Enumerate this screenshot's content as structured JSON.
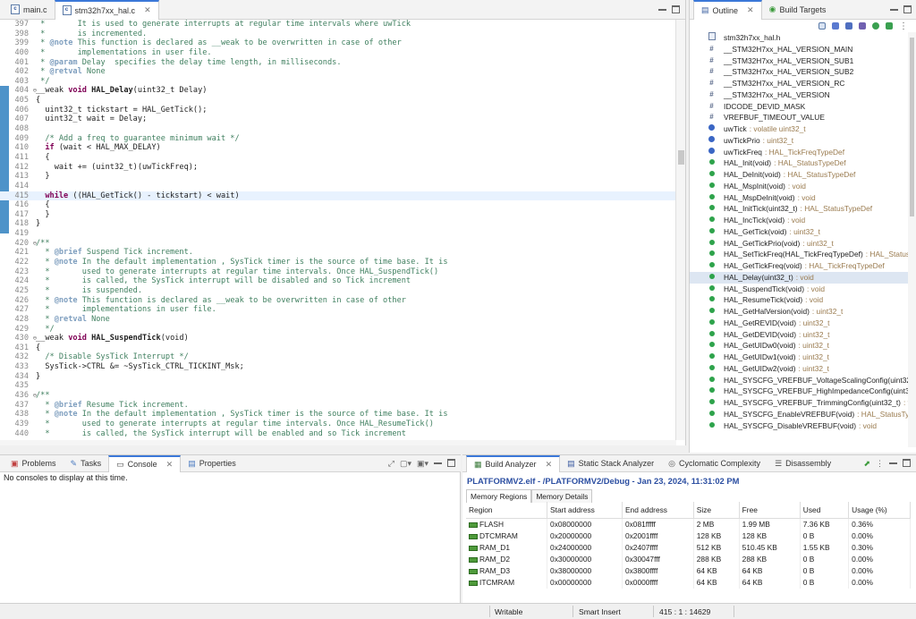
{
  "editor": {
    "tabs": [
      {
        "label": "main.c",
        "active": false
      },
      {
        "label": "stm32h7xx_hal.c",
        "active": true
      }
    ],
    "lines": [
      {
        "n": "397",
        "fold": "",
        "segs": [
          [
            "cm",
            " *       It is used to generate interrupts at regular time intervals where uwTick"
          ]
        ]
      },
      {
        "n": "398",
        "fold": "",
        "segs": [
          [
            "cm",
            " *       is incremented."
          ]
        ]
      },
      {
        "n": "399",
        "fold": "",
        "segs": [
          [
            "cm",
            " * "
          ],
          [
            "tg",
            "@note"
          ],
          [
            "cm",
            " This function is declared as __weak to be overwritten in case of other"
          ]
        ]
      },
      {
        "n": "400",
        "fold": "",
        "segs": [
          [
            "cm",
            " *       implementations in user file."
          ]
        ]
      },
      {
        "n": "401",
        "fold": "",
        "segs": [
          [
            "cm",
            " * "
          ],
          [
            "tg",
            "@param"
          ],
          [
            "cm",
            " Delay  specifies the delay time length, in milliseconds."
          ]
        ]
      },
      {
        "n": "402",
        "fold": "",
        "segs": [
          [
            "cm",
            " * "
          ],
          [
            "tg",
            "@retval"
          ],
          [
            "cm",
            " None"
          ]
        ]
      },
      {
        "n": "403",
        "fold": "",
        "segs": [
          [
            "cm",
            " */"
          ]
        ]
      },
      {
        "n": "404",
        "fold": "⊖",
        "segs": [
          [
            "",
            "__weak "
          ],
          [
            "kw",
            "void"
          ],
          [
            "",
            ""
          ],
          [
            "b",
            " HAL_Delay"
          ],
          [
            "",
            "(uint32_t Delay)"
          ]
        ]
      },
      {
        "n": "405",
        "fold": "",
        "segs": [
          [
            "",
            "{"
          ]
        ]
      },
      {
        "n": "406",
        "fold": "",
        "segs": [
          [
            "",
            "  uint32_t tickstart = HAL_GetTick();"
          ]
        ]
      },
      {
        "n": "407",
        "fold": "",
        "segs": [
          [
            "",
            "  uint32_t wait = Delay;"
          ]
        ]
      },
      {
        "n": "408",
        "fold": "",
        "segs": [
          [
            "",
            ""
          ]
        ]
      },
      {
        "n": "409",
        "fold": "",
        "segs": [
          [
            "cm",
            "  /* Add a freq to guarantee minimum wait */"
          ]
        ]
      },
      {
        "n": "410",
        "fold": "",
        "segs": [
          [
            "kw",
            "  if"
          ],
          [
            "",
            " (wait < HAL_MAX_DELAY)"
          ]
        ]
      },
      {
        "n": "411",
        "fold": "",
        "segs": [
          [
            "",
            "  {"
          ]
        ]
      },
      {
        "n": "412",
        "fold": "",
        "segs": [
          [
            "",
            "    wait += (uint32_t)(uwTickFreq);"
          ]
        ]
      },
      {
        "n": "413",
        "fold": "",
        "segs": [
          [
            "",
            "  }"
          ]
        ]
      },
      {
        "n": "414",
        "fold": "",
        "segs": [
          [
            "",
            ""
          ]
        ]
      },
      {
        "n": "415",
        "fold": "",
        "cur": true,
        "segs": [
          [
            "kw",
            "  while"
          ],
          [
            "",
            " ((HAL_GetTick() - tickstart) < wait)"
          ]
        ]
      },
      {
        "n": "416",
        "fold": "",
        "segs": [
          [
            "",
            "  {"
          ]
        ]
      },
      {
        "n": "417",
        "fold": "",
        "segs": [
          [
            "",
            "  }"
          ]
        ]
      },
      {
        "n": "418",
        "fold": "",
        "segs": [
          [
            "",
            "}"
          ]
        ]
      },
      {
        "n": "419",
        "fold": "",
        "segs": [
          [
            "",
            ""
          ]
        ]
      },
      {
        "n": "420",
        "fold": "⊖",
        "segs": [
          [
            "cm",
            "/**"
          ]
        ]
      },
      {
        "n": "421",
        "fold": "",
        "segs": [
          [
            "cm",
            "  * "
          ],
          [
            "tg",
            "@brief"
          ],
          [
            "cm",
            " Suspend Tick increment."
          ]
        ]
      },
      {
        "n": "422",
        "fold": "",
        "segs": [
          [
            "cm",
            "  * "
          ],
          [
            "tg",
            "@note"
          ],
          [
            "cm",
            " In the default implementation , SysTick timer is the source of time base. It is"
          ]
        ]
      },
      {
        "n": "423",
        "fold": "",
        "segs": [
          [
            "cm",
            "  *       used to generate interrupts at regular time intervals. Once HAL_SuspendTick()"
          ]
        ]
      },
      {
        "n": "424",
        "fold": "",
        "segs": [
          [
            "cm",
            "  *       is called, the SysTick interrupt will be disabled and so Tick increment"
          ]
        ]
      },
      {
        "n": "425",
        "fold": "",
        "segs": [
          [
            "cm",
            "  *       is suspended."
          ]
        ]
      },
      {
        "n": "426",
        "fold": "",
        "segs": [
          [
            "cm",
            "  * "
          ],
          [
            "tg",
            "@note"
          ],
          [
            "cm",
            " This function is declared as __weak to be overwritten in case of other"
          ]
        ]
      },
      {
        "n": "427",
        "fold": "",
        "segs": [
          [
            "cm",
            "  *       implementations in user file."
          ]
        ]
      },
      {
        "n": "428",
        "fold": "",
        "segs": [
          [
            "cm",
            "  * "
          ],
          [
            "tg",
            "@retval"
          ],
          [
            "cm",
            " None"
          ]
        ]
      },
      {
        "n": "429",
        "fold": "",
        "segs": [
          [
            "cm",
            "  */"
          ]
        ]
      },
      {
        "n": "430",
        "fold": "⊖",
        "segs": [
          [
            "",
            "__weak "
          ],
          [
            "kw",
            "void"
          ],
          [
            "b",
            " HAL_SuspendTick"
          ],
          [
            "",
            "(void)"
          ]
        ]
      },
      {
        "n": "431",
        "fold": "",
        "segs": [
          [
            "",
            "{"
          ]
        ]
      },
      {
        "n": "432",
        "fold": "",
        "segs": [
          [
            "cm",
            "  /* Disable SysTick Interrupt */"
          ]
        ]
      },
      {
        "n": "433",
        "fold": "",
        "segs": [
          [
            "",
            "  SysTick->CTRL &= ~SysTick_CTRL_TICKINT_Msk;"
          ]
        ]
      },
      {
        "n": "434",
        "fold": "",
        "segs": [
          [
            "",
            "}"
          ]
        ]
      },
      {
        "n": "435",
        "fold": "",
        "segs": [
          [
            "",
            ""
          ]
        ]
      },
      {
        "n": "436",
        "fold": "⊖",
        "segs": [
          [
            "cm",
            "/**"
          ]
        ]
      },
      {
        "n": "437",
        "fold": "",
        "segs": [
          [
            "cm",
            "  * "
          ],
          [
            "tg",
            "@brief"
          ],
          [
            "cm",
            " Resume Tick increment."
          ]
        ]
      },
      {
        "n": "438",
        "fold": "",
        "segs": [
          [
            "cm",
            "  * "
          ],
          [
            "tg",
            "@note"
          ],
          [
            "cm",
            " In the default implementation , SysTick timer is the source of time base. It is"
          ]
        ]
      },
      {
        "n": "439",
        "fold": "",
        "segs": [
          [
            "cm",
            "  *       used to generate interrupts at regular time intervals. Once HAL_ResumeTick()"
          ]
        ]
      },
      {
        "n": "440",
        "fold": "",
        "segs": [
          [
            "cm",
            "  *       is called, the SysTick interrupt will be enabled and so Tick increment"
          ]
        ]
      }
    ]
  },
  "outline": {
    "tabs": [
      {
        "label": "Outline",
        "active": true
      },
      {
        "label": "Build Targets",
        "active": false
      }
    ],
    "items": [
      {
        "icon": "h",
        "name": "stm32h7xx_hal.h",
        "type": ""
      },
      {
        "icon": "m",
        "name": "__STM32H7xx_HAL_VERSION_MAIN",
        "type": ""
      },
      {
        "icon": "m",
        "name": "__STM32H7xx_HAL_VERSION_SUB1",
        "type": ""
      },
      {
        "icon": "m",
        "name": "__STM32H7xx_HAL_VERSION_SUB2",
        "type": ""
      },
      {
        "icon": "m",
        "name": "__STM32H7xx_HAL_VERSION_RC",
        "type": ""
      },
      {
        "icon": "m",
        "name": "__STM32H7xx_HAL_VERSION",
        "type": ""
      },
      {
        "icon": "m",
        "name": "IDCODE_DEVID_MASK",
        "type": ""
      },
      {
        "icon": "m",
        "name": "VREFBUF_TIMEOUT_VALUE",
        "type": ""
      },
      {
        "icon": "v",
        "name": "uwTick",
        "type": ": volatile uint32_t"
      },
      {
        "icon": "v",
        "name": "uwTickPrio",
        "type": ": uint32_t"
      },
      {
        "icon": "v",
        "name": "uwTickFreq",
        "type": ": HAL_TickFreqTypeDef"
      },
      {
        "icon": "f",
        "name": "HAL_Init(void)",
        "type": ": HAL_StatusTypeDef"
      },
      {
        "icon": "f",
        "name": "HAL_DeInit(void)",
        "type": ": HAL_StatusTypeDef"
      },
      {
        "icon": "f",
        "name": "HAL_MspInit(void)",
        "type": ": void"
      },
      {
        "icon": "f",
        "name": "HAL_MspDeInit(void)",
        "type": ": void"
      },
      {
        "icon": "f",
        "name": "HAL_InitTick(uint32_t)",
        "type": ": HAL_StatusTypeDef"
      },
      {
        "icon": "f",
        "name": "HAL_IncTick(void)",
        "type": ": void"
      },
      {
        "icon": "f",
        "name": "HAL_GetTick(void)",
        "type": ": uint32_t"
      },
      {
        "icon": "f",
        "name": "HAL_GetTickPrio(void)",
        "type": ": uint32_t"
      },
      {
        "icon": "f",
        "name": "HAL_SetTickFreq(HAL_TickFreqTypeDef)",
        "type": ": HAL_StatusTy"
      },
      {
        "icon": "f",
        "name": "HAL_GetTickFreq(void)",
        "type": ": HAL_TickFreqTypeDef"
      },
      {
        "icon": "f",
        "name": "HAL_Delay(uint32_t)",
        "type": ": void",
        "sel": true
      },
      {
        "icon": "f",
        "name": "HAL_SuspendTick(void)",
        "type": ": void"
      },
      {
        "icon": "f",
        "name": "HAL_ResumeTick(void)",
        "type": ": void"
      },
      {
        "icon": "f",
        "name": "HAL_GetHalVersion(void)",
        "type": ": uint32_t"
      },
      {
        "icon": "f",
        "name": "HAL_GetREVID(void)",
        "type": ": uint32_t"
      },
      {
        "icon": "f",
        "name": "HAL_GetDEVID(void)",
        "type": ": uint32_t"
      },
      {
        "icon": "f",
        "name": "HAL_GetUIDw0(void)",
        "type": ": uint32_t"
      },
      {
        "icon": "f",
        "name": "HAL_GetUIDw1(void)",
        "type": ": uint32_t"
      },
      {
        "icon": "f",
        "name": "HAL_GetUIDw2(void)",
        "type": ": uint32_t"
      },
      {
        "icon": "f",
        "name": "HAL_SYSCFG_VREFBUF_VoltageScalingConfig(uint32_t)",
        "type": ""
      },
      {
        "icon": "f",
        "name": "HAL_SYSCFG_VREFBUF_HighImpedanceConfig(uint32_",
        "type": ""
      },
      {
        "icon": "f",
        "name": "HAL_SYSCFG_VREFBUF_TrimmingConfig(uint32_t)",
        "type": ": vo"
      },
      {
        "icon": "f",
        "name": "HAL_SYSCFG_EnableVREFBUF(void)",
        "type": ": HAL_StatusTypeD"
      },
      {
        "icon": "f",
        "name": "HAL_SYSCFG_DisableVREFBUF(void)",
        "type": ": void"
      }
    ]
  },
  "console": {
    "tabs": [
      {
        "label": "Problems",
        "active": false
      },
      {
        "label": "Tasks",
        "active": false
      },
      {
        "label": "Console",
        "active": true
      },
      {
        "label": "Properties",
        "active": false
      }
    ],
    "message": "No consoles to display at this time."
  },
  "build": {
    "tabs": [
      {
        "label": "Build Analyzer",
        "active": true
      },
      {
        "label": "Static Stack Analyzer",
        "active": false
      },
      {
        "label": "Cyclomatic Complexity",
        "active": false
      },
      {
        "label": "Disassembly",
        "active": false
      }
    ],
    "title": "PLATFORMV2.elf - /PLATFORMV2/Debug - Jan 23, 2024, 11:31:02 PM",
    "subtabs": [
      "Memory Regions",
      "Memory Details"
    ],
    "headers": [
      "Region",
      "Start address",
      "End address",
      "Size",
      "Free",
      "Used",
      "Usage (%)"
    ],
    "rows": [
      [
        "FLASH",
        "0x08000000",
        "0x081fffff",
        "2 MB",
        "1.99 MB",
        "7.36 KB",
        "0.36%"
      ],
      [
        "DTCMRAM",
        "0x20000000",
        "0x2001ffff",
        "128 KB",
        "128 KB",
        "0 B",
        "0.00%"
      ],
      [
        "RAM_D1",
        "0x24000000",
        "0x2407ffff",
        "512 KB",
        "510.45 KB",
        "1.55 KB",
        "0.30%"
      ],
      [
        "RAM_D2",
        "0x30000000",
        "0x30047fff",
        "288 KB",
        "288 KB",
        "0 B",
        "0.00%"
      ],
      [
        "RAM_D3",
        "0x38000000",
        "0x3800ffff",
        "64 KB",
        "64 KB",
        "0 B",
        "0.00%"
      ],
      [
        "ITCMRAM",
        "0x00000000",
        "0x0000ffff",
        "64 KB",
        "64 KB",
        "0 B",
        "0.00%"
      ]
    ]
  },
  "status": {
    "mode": "Writable",
    "insert": "Smart Insert",
    "position": "415 : 1 : 14629"
  }
}
